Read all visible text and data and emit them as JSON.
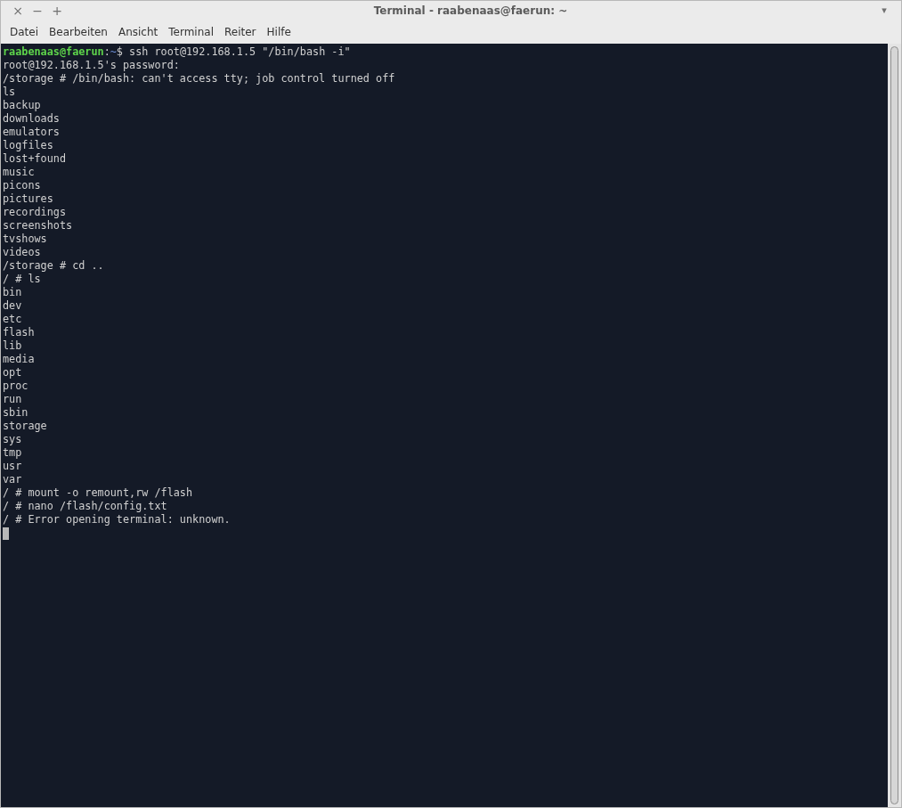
{
  "window": {
    "title": "Terminal - raabenaas@faerun: ~",
    "controls": [
      "×",
      "−",
      "+"
    ],
    "menu_arrow": "▾"
  },
  "menu": [
    "Datei",
    "Bearbeiten",
    "Ansicht",
    "Terminal",
    "Reiter",
    "Hilfe"
  ],
  "terminal": {
    "cursor": true,
    "lines": [
      {
        "kind": "prompt",
        "user_host": "raabenaas@faerun",
        "separator": ":",
        "path": "~",
        "command": "$ ssh root@192.168.1.5 \"/bin/bash -i\""
      },
      {
        "kind": "output",
        "text": "root@192.168.1.5's password:"
      },
      {
        "kind": "output",
        "text": "/storage # /bin/bash: can't access tty; job control turned off"
      },
      {
        "kind": "output",
        "text": "ls"
      },
      {
        "kind": "output",
        "text": "backup"
      },
      {
        "kind": "output",
        "text": "downloads"
      },
      {
        "kind": "output",
        "text": "emulators"
      },
      {
        "kind": "output",
        "text": "logfiles"
      },
      {
        "kind": "output",
        "text": "lost+found"
      },
      {
        "kind": "output",
        "text": "music"
      },
      {
        "kind": "output",
        "text": "picons"
      },
      {
        "kind": "output",
        "text": "pictures"
      },
      {
        "kind": "output",
        "text": "recordings"
      },
      {
        "kind": "output",
        "text": "screenshots"
      },
      {
        "kind": "output",
        "text": "tvshows"
      },
      {
        "kind": "output",
        "text": "videos"
      },
      {
        "kind": "output",
        "text": "/storage # cd .."
      },
      {
        "kind": "output",
        "text": "/ # ls"
      },
      {
        "kind": "output",
        "text": "bin"
      },
      {
        "kind": "output",
        "text": "dev"
      },
      {
        "kind": "output",
        "text": "etc"
      },
      {
        "kind": "output",
        "text": "flash"
      },
      {
        "kind": "output",
        "text": "lib"
      },
      {
        "kind": "output",
        "text": "media"
      },
      {
        "kind": "output",
        "text": "opt"
      },
      {
        "kind": "output",
        "text": "proc"
      },
      {
        "kind": "output",
        "text": "run"
      },
      {
        "kind": "output",
        "text": "sbin"
      },
      {
        "kind": "output",
        "text": "storage"
      },
      {
        "kind": "output",
        "text": "sys"
      },
      {
        "kind": "output",
        "text": "tmp"
      },
      {
        "kind": "output",
        "text": "usr"
      },
      {
        "kind": "output",
        "text": "var"
      },
      {
        "kind": "output",
        "text": "/ # mount -o remount,rw /flash"
      },
      {
        "kind": "output",
        "text": "/ # nano /flash/config.txt"
      },
      {
        "kind": "output",
        "text": "/ # Error opening terminal: unknown."
      }
    ]
  }
}
